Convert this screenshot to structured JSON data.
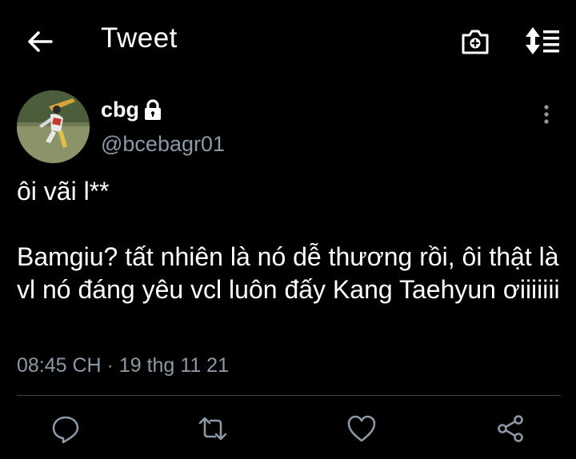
{
  "header": {
    "title": "Tweet",
    "back_icon": "arrow-left-icon",
    "camera_icon": "camera-icon",
    "sort_icon": "sort-updown-icon"
  },
  "tweet": {
    "display_name": "cbg",
    "protected_icon": "lock-icon",
    "handle": "@bcebagr01",
    "text_paragraphs": [
      "ôi vãi l**",
      "Bamgiu? tất nhiên là nó dễ thương rồi, ôi thật là vl nó đáng yêu vcl luôn đấy Kang Taehyun ơiiiiiii"
    ],
    "timestamp": "08:45 CH · 19 thg 11 21"
  },
  "actions": [
    "reply-icon",
    "retweet-icon",
    "like-icon",
    "share-icon"
  ],
  "colors": {
    "background": "#000000",
    "text": "#ffffff",
    "secondary": "#8b98a5",
    "divider": "#38444d"
  }
}
